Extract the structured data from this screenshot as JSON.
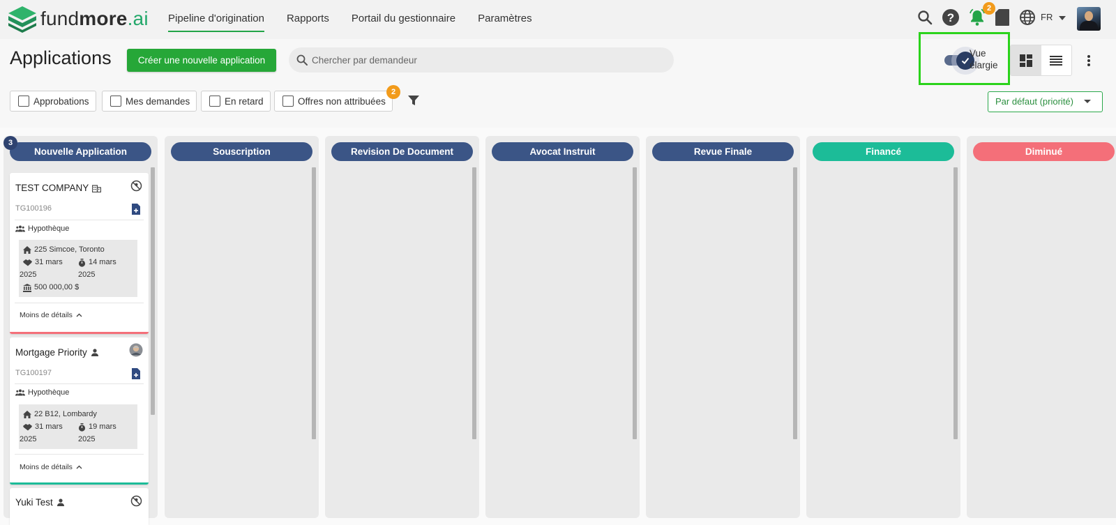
{
  "brand": {
    "part1": "fund",
    "part2": "more",
    "part3": ".ai"
  },
  "nav": {
    "items": [
      {
        "label": "Pipeline d'origination"
      },
      {
        "label": "Rapports"
      },
      {
        "label": "Portail du gestionnaire"
      },
      {
        "label": "Paramètres"
      }
    ]
  },
  "topbar": {
    "notifications_count": "2",
    "language": "FR"
  },
  "header": {
    "title": "Applications",
    "create_button": "Créer une nouvelle application",
    "search_placeholder": "Chercher par demandeur",
    "toggle_label_line1": "Vue",
    "toggle_label_line2": "élargie",
    "toggle_on": true
  },
  "filters": {
    "chips": [
      {
        "label": "Approbations",
        "checked": false
      },
      {
        "label": "Mes demandes",
        "checked": false
      },
      {
        "label": "En retard",
        "checked": false
      },
      {
        "label": "Offres non attribuées",
        "checked": false
      }
    ],
    "unassigned_badge": "2",
    "sort_value": "Par défaut (priorité)"
  },
  "colors": {
    "stage_blue": "#3b5586",
    "funded": "#1cbc98",
    "declined": "#f46f79",
    "brand_green": "#26a738",
    "highlight": "#2bd31b"
  },
  "board": {
    "columns": [
      {
        "title": "Nouvelle Application",
        "count": "3",
        "color": "#3b5586"
      },
      {
        "title": "Souscription",
        "color": "#3b5586"
      },
      {
        "title": "Revision De Document",
        "color": "#3b5586"
      },
      {
        "title": "Avocat Instruit",
        "color": "#3b5586"
      },
      {
        "title": "Revue Finale",
        "color": "#3b5586"
      },
      {
        "title": "Financé",
        "color": "#1cbc98"
      },
      {
        "title": "Diminué",
        "color": "#f46f79"
      }
    ],
    "cards": [
      {
        "name": "TEST COMPANY",
        "applicant_icon": "company-icon",
        "ref": "TG100196",
        "product": "Hypothèque",
        "address": "225 Simcoe, Toronto",
        "closing_date_line1": "31 mars",
        "closing_date_line2": "2025",
        "cof_date_line1": "14 mars",
        "cof_date_line2": "2025",
        "amount": "500 000,00 $",
        "less_details": "Moins de détails",
        "status_color": "#f46f79"
      },
      {
        "name": "Mortgage Priority",
        "applicant_icon": "person-icon",
        "ref": "TG100197",
        "product": "Hypothèque",
        "address": "22 B12, Lombardy",
        "closing_date_line1": "31 mars",
        "closing_date_line2": "2025",
        "cof_date_line1": "19 mars",
        "cof_date_line2": "2025",
        "less_details": "Moins de détails",
        "status_color": "#1cbc98"
      },
      {
        "name": "Yuki Test",
        "applicant_icon": "person-icon"
      }
    ]
  }
}
